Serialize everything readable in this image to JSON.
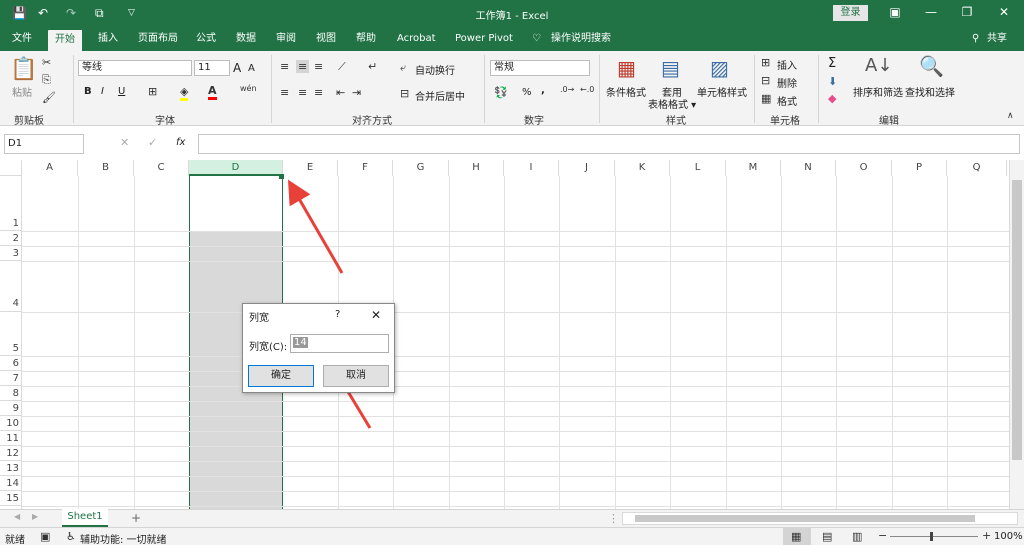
{
  "titlebar": {
    "title": "工作簿1  -  Excel",
    "login": "登录"
  },
  "tabs": [
    "文件",
    "开始",
    "插入",
    "页面布局",
    "公式",
    "数据",
    "审阅",
    "视图",
    "帮助",
    "Acrobat",
    "Power Pivot",
    "操作说明搜索"
  ],
  "share": "共享",
  "ribbon": {
    "paste": "粘贴",
    "clipboard": "剪贴板",
    "font_name": "等线",
    "font_size": "11",
    "font_grow": "A",
    "font_shrink": "A",
    "bold": "B",
    "italic": "I",
    "underline": "U",
    "font_group": "字体",
    "wrap": "自动换行",
    "merge": "合并后居中",
    "align_group": "对齐方式",
    "number_format": "常规",
    "percent": "%",
    "comma": ",",
    "number_group": "数字",
    "cond_format": "条件格式",
    "table_format": "套用\n表格格式",
    "cell_style": "单元格样式",
    "style_group": "样式",
    "insert": "插入",
    "delete": "删除",
    "format": "格式",
    "cells_group": "单元格",
    "sigma": "Σ",
    "sort_filter": "排序和筛选",
    "find_select": "查找和选择",
    "edit_group": "编辑"
  },
  "formula": {
    "namebox": "D1",
    "fx": "fx"
  },
  "columns": [
    "A",
    "B",
    "C",
    "D",
    "E",
    "F",
    "G",
    "H",
    "I",
    "J",
    "K",
    "L",
    "M",
    "N",
    "O",
    "P",
    "Q"
  ],
  "rows": [
    "1",
    "2",
    "3",
    "4",
    "5",
    "6",
    "7",
    "8",
    "9",
    "10",
    "11",
    "12",
    "13",
    "14",
    "15"
  ],
  "dialog": {
    "title": "列宽",
    "help": "?",
    "close": "✕",
    "label": "列宽(C):",
    "value": "14",
    "ok": "确定",
    "cancel": "取消"
  },
  "sheet": {
    "tab": "Sheet1",
    "add": "+"
  },
  "status": {
    "ready": "就绪",
    "accessibility": "辅助功能: 一切就绪",
    "zoom": "100%"
  },
  "colors": {
    "brand": "#217346",
    "selection": "#d9d9d9",
    "arrow": "#e8413a"
  }
}
